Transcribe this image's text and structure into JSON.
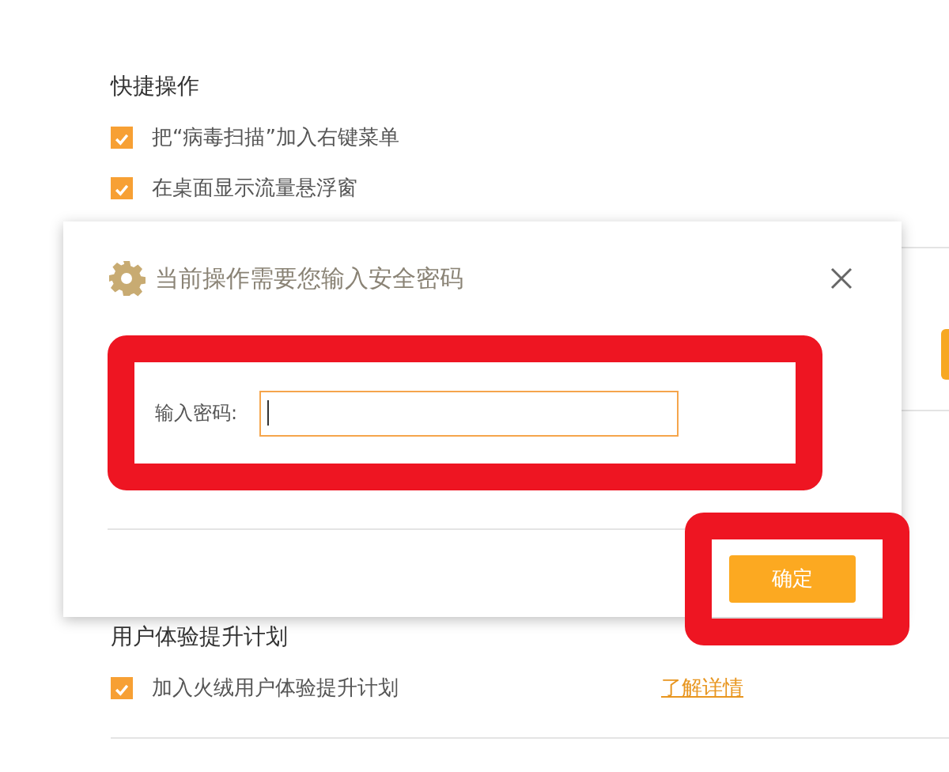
{
  "background": {
    "section_title": "快捷操作",
    "options": [
      {
        "label": "把“病毒扫描”加入右键菜单",
        "checked": true
      },
      {
        "label": "在桌面显示流量悬浮窗",
        "checked": true
      }
    ],
    "section2_title": "用户体验提升计划",
    "options2": [
      {
        "label": "加入火绒用户体验提升计划",
        "checked": true,
        "link": "了解详情"
      }
    ]
  },
  "dialog": {
    "title": "当前操作需要您输入安全密码",
    "field_label": "输入密码:",
    "confirm_button": "确定"
  }
}
